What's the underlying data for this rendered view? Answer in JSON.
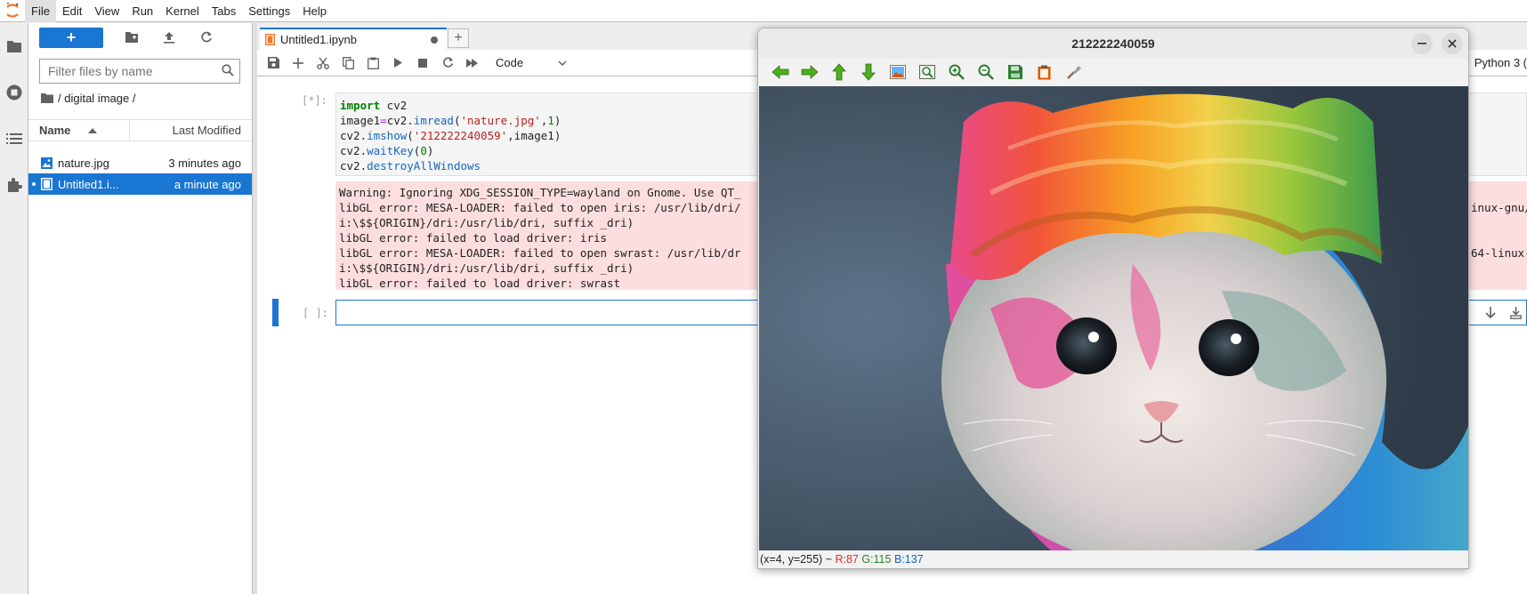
{
  "menubar": {
    "items": [
      "File",
      "Edit",
      "View",
      "Run",
      "Kernel",
      "Tabs",
      "Settings",
      "Help"
    ],
    "active": "File"
  },
  "filebrowser": {
    "new_label": "+",
    "search_placeholder": "Filter files by name",
    "breadcrumb": "/ digital image /",
    "columns": {
      "name": "Name",
      "modified": "Last Modified"
    },
    "files": [
      {
        "name": "nature.jpg",
        "modified": "3 minutes ago",
        "type": "image",
        "selected": false
      },
      {
        "name": "Untitled1.i...",
        "modified": "a minute ago",
        "type": "notebook",
        "selected": true
      }
    ]
  },
  "notebook": {
    "tab_label": "Untitled1.ipynb",
    "tab_add": "+",
    "cell_type": "Code",
    "kernel": "Python 3 (",
    "running_prompt": "[*]:",
    "empty_prompt": "[ ]:",
    "code_lines": [
      "import cv2",
      "image1=cv2.imread('nature.jpg',1)",
      "cv2.imshow('212222240059',image1)",
      "cv2.waitKey(0)",
      "cv2.destroyAllWindows"
    ],
    "output_left": [
      "Warning: Ignoring XDG_SESSION_TYPE=wayland on Gnome. Use QT_",
      "libGL error: MESA-LOADER: failed to open iris: /usr/lib/dri/",
      "i:\\$${ORIGIN}/dri:/usr/lib/dri, suffix _dri)",
      "libGL error: failed to load driver: iris",
      "libGL error: MESA-LOADER: failed to open swrast: /usr/lib/dr",
      "i:\\$${ORIGIN}/dri:/usr/lib/dri, suffix _dri)",
      "libGL error: failed to load driver: swrast"
    ],
    "output_right": [
      "",
      "inux-gnu/",
      "",
      "",
      "64-linux-",
      "",
      ""
    ]
  },
  "image_window": {
    "title": "212222240059",
    "status": {
      "coords": "(x=4, y=255) ~",
      "r": "R:87",
      "g": "G:115",
      "b": "B:137"
    },
    "tools": [
      "pan-left-icon",
      "pan-right-icon",
      "pan-up-icon",
      "pan-down-icon",
      "zoom-original-icon",
      "zoom-fit-icon",
      "zoom-in-icon",
      "zoom-out-icon",
      "save-icon",
      "copy-icon",
      "properties-icon"
    ]
  },
  "colors": {
    "accent": "#1976d2",
    "error_bg": "#fddede",
    "status_r": "#d32f2f",
    "status_g": "#2e7d32",
    "status_b": "#1565c0"
  }
}
